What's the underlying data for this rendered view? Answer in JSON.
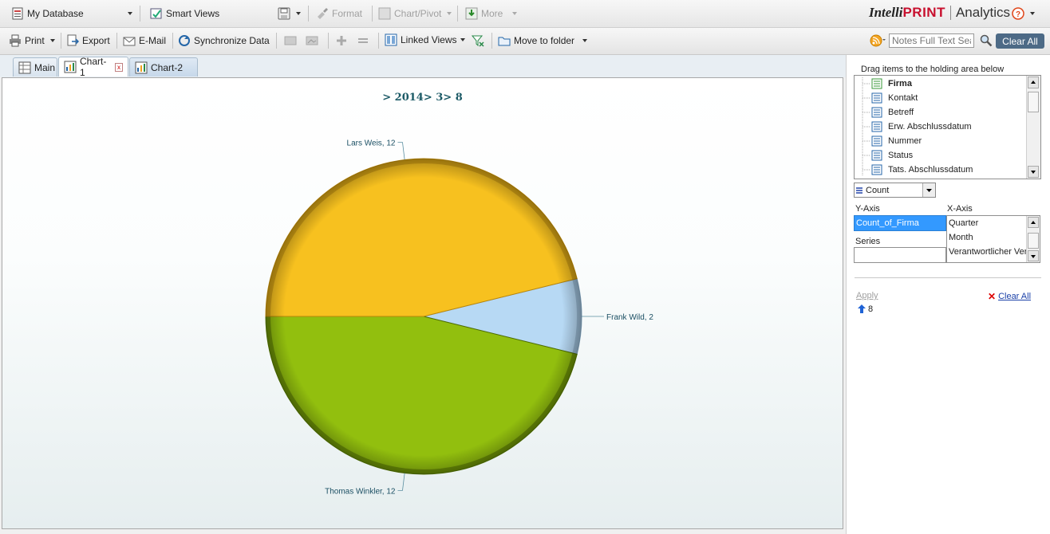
{
  "toolbar1": {
    "database_label": "My Database",
    "smart_views_label": "Smart Views",
    "format_label": "Format",
    "chart_pivot_label": "Chart/Pivot",
    "more_label": "More"
  },
  "brand": {
    "part1": "Intelli",
    "part2": "PRINT",
    "part3": "Analytics"
  },
  "toolbar2": {
    "print_label": "Print",
    "export_label": "Export",
    "email_label": "E-Mail",
    "sync_label": "Synchronize Data",
    "linked_views_label": "Linked Views",
    "move_folder_label": "Move to folder",
    "search_placeholder": "Notes Full Text Search",
    "clear_all_label": "Clear All"
  },
  "tabs": [
    {
      "label": "Main"
    },
    {
      "label": "Chart-1"
    },
    {
      "label": "Chart-2"
    }
  ],
  "tab_close_glyph": "x",
  "chart_data": {
    "type": "pie",
    "title": "> 2014> 3> 8",
    "slices": [
      {
        "label": "Frank Wild, 2",
        "value": 2,
        "color": "#b7d9f4",
        "edge": "#7f9fb8"
      },
      {
        "label": "Thomas Winkler, 12",
        "value": 12,
        "color": "#92bf0e",
        "edge": "#4e6e00"
      },
      {
        "label": "Lars Weis, 12",
        "value": 12,
        "color": "#f7c11f",
        "edge": "#b8860b"
      }
    ]
  },
  "panel": {
    "drag_hint": "Drag items to the holding area below",
    "fields": [
      "Firma",
      "Kontakt",
      "Betreff",
      "Erw. Abschlussdatum",
      "Nummer",
      "Status",
      "Tats. Abschlussdatum"
    ],
    "aggregate_select": "Count",
    "y_axis_label": "Y-Axis",
    "x_axis_label": "X-Axis",
    "series_label": "Series",
    "y_axis_value": "Count_of_Firma",
    "x_axis_items": [
      "Quarter",
      "Month",
      "Verantwortlicher Verkäufer"
    ],
    "apply_label": "Apply",
    "clear_all_label": "Clear All",
    "level_value": "8"
  },
  "colors": {
    "accent": "#4d6a86",
    "title": "#1b5a66",
    "selected": "#3399ff"
  }
}
